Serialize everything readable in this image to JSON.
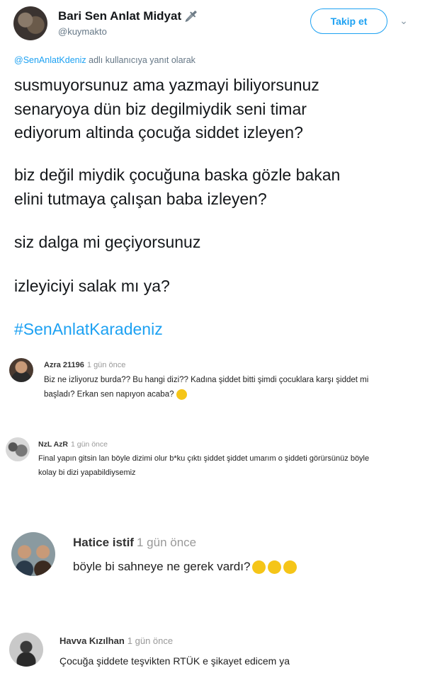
{
  "tweet": {
    "display_name": "Bari Sen Anlat Midyat",
    "name_emoji": "🗡",
    "handle": "@kuymakto",
    "follow_label": "Takip et",
    "chevron": "⌄",
    "reply_to_link": "@SenAnlatKdeniz",
    "reply_to_suffix": " adlı kullanıcıya yanıt olarak",
    "lines": [
      "susmuyorsunuz ama yazmayi biliyorsunuz",
      "senaryoya dün biz degilmiydik seni timar",
      "ediyorum altinda çocuğa siddet izleyen?",
      "biz değil miydik çocuğuna baska gözle bakan",
      "elini tutmaya çalışan baba izleyen?",
      "siz dalga mi geçiyorsunuz",
      "izleyiciyi salak mı ya?"
    ],
    "hashtag": "#SenAnlatKaradeniz"
  },
  "comments": [
    {
      "name": "Azra 21196",
      "time": "1 gün önce",
      "line1": "Biz ne izliyoruz burda?? Bu hangi dizi?? Kadına şiddet bitti şimdi çocuklara karşı şiddet mi",
      "line2": "başladı? Erkan sen napıyon acaba?"
    },
    {
      "name": "NzL AzR",
      "time": "1 gün önce",
      "line1": "Final yapın gitsin lan böyle dizimi olur b*ku çıktı şiddet şiddet umarım o şiddeti görürsünüz böyle",
      "line2": "kolay bi dizi yapabildiysemiz"
    },
    {
      "name": "Hatice istif",
      "time": "1 gün önce",
      "line1": "böyle bi sahneye ne gerek vardı?"
    },
    {
      "name": "Havva Kızılhan",
      "time": "1 gün önce",
      "line1": "Çocuğa şiddete teşvikten RTÜK e şikayet edicem ya"
    }
  ],
  "colors": {
    "twitter_blue": "#1da1f2",
    "emoji_yellow": "#f5c518"
  }
}
